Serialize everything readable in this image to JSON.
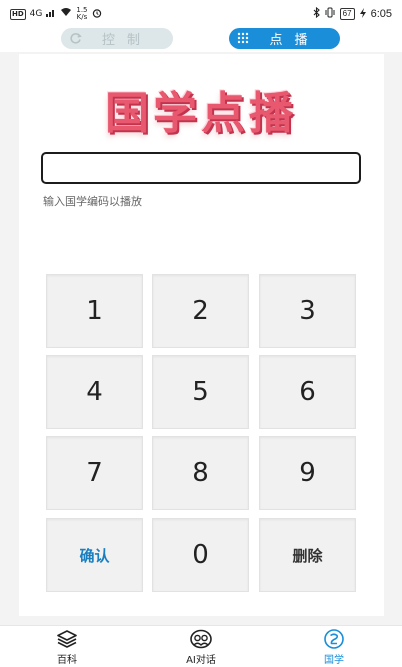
{
  "status_bar": {
    "hd": "HD",
    "signal": "4G",
    "speed_value": "1.5",
    "speed_unit": "K/s",
    "battery": "67",
    "time": "6:05"
  },
  "header": {
    "tab_control": "控制",
    "tab_play": "点播",
    "icon_control": "refresh-icon",
    "icon_play": "keypad-icon"
  },
  "main": {
    "title": "国学点播",
    "code_input": {
      "value": "",
      "placeholder": ""
    },
    "hint": "输入国学编码以播放",
    "keys": [
      "1",
      "2",
      "3",
      "4",
      "5",
      "6",
      "7",
      "8",
      "9"
    ],
    "confirm_label": "确认",
    "zero_label": "0",
    "delete_label": "删除"
  },
  "bottom_nav": {
    "items": [
      {
        "label": "百科",
        "icon": "layers-icon"
      },
      {
        "label": "AI对话",
        "icon": "chat-faces-icon"
      },
      {
        "label": "国学",
        "icon": "guoxue-icon"
      }
    ],
    "active_index": 2
  },
  "colors": {
    "accent": "#1a8ed8",
    "title": "#e8586e",
    "confirm": "#1a7fc0"
  }
}
